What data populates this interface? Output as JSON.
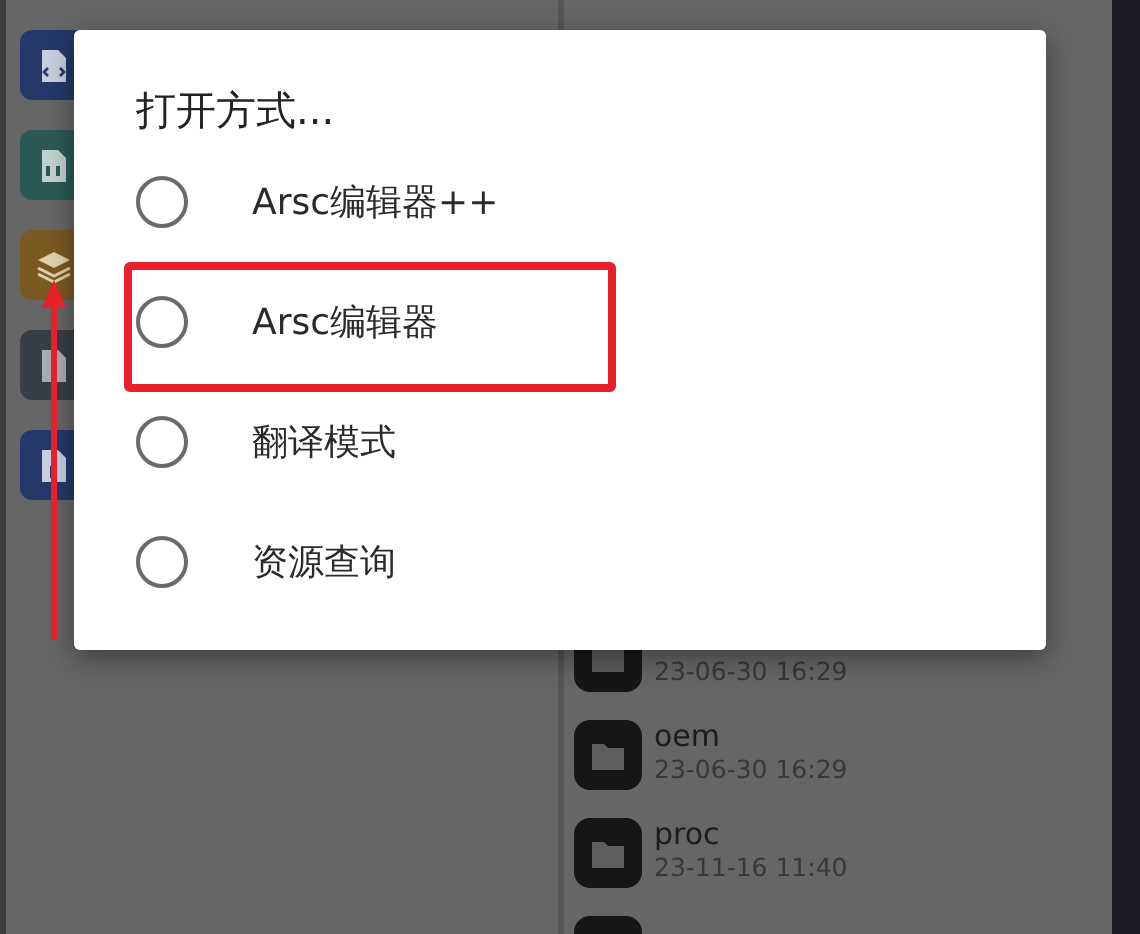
{
  "sidebar": {
    "tiles": [
      {
        "kind": "code",
        "color": "#24396a"
      },
      {
        "kind": "binary",
        "color": "#2b5a55"
      },
      {
        "kind": "layers",
        "color": "#7a5a22"
      },
      {
        "kind": "file",
        "color": "#383e46"
      },
      {
        "kind": "archive",
        "color": "#24396a"
      }
    ]
  },
  "files": [
    {
      "kind": "folder",
      "time": "23-06-30 16:29"
    },
    {
      "kind": "folder",
      "name": "oem",
      "time": "23-06-30 16:29"
    },
    {
      "kind": "folder",
      "name": "proc",
      "time": "23-11-16 11:40"
    },
    {
      "kind": "folder"
    }
  ],
  "dialog": {
    "title": "打开方式...",
    "options": [
      {
        "label": "Arsc编辑器++",
        "selected": false,
        "highlighted": false
      },
      {
        "label": "Arsc编辑器",
        "selected": false,
        "highlighted": true
      },
      {
        "label": "翻译模式",
        "selected": false,
        "highlighted": false
      },
      {
        "label": "资源查询",
        "selected": false,
        "highlighted": false
      }
    ]
  },
  "annotation": {
    "arrow": true
  }
}
